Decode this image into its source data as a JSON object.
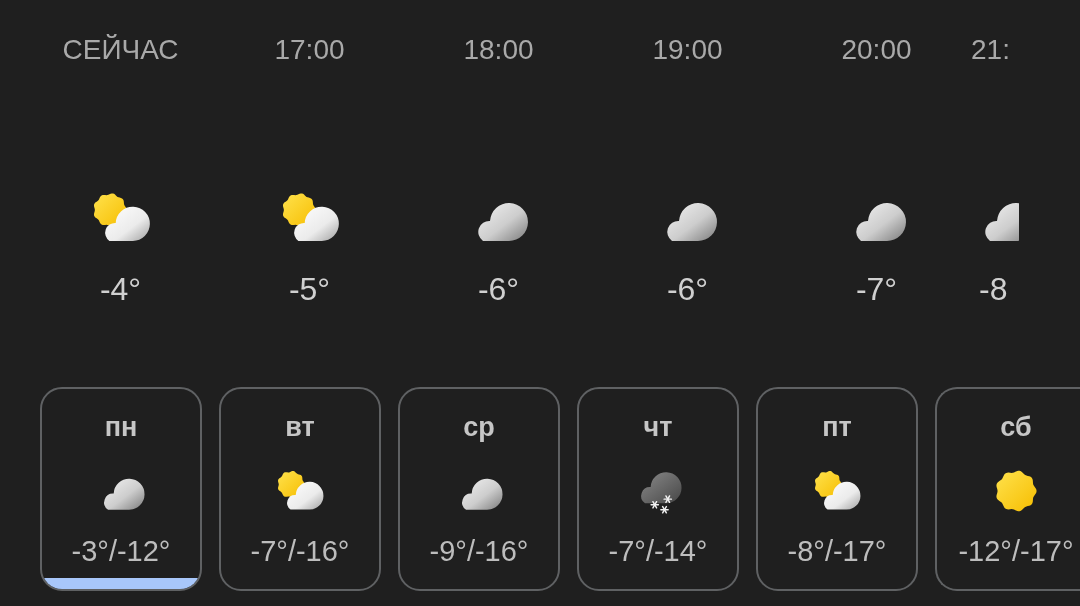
{
  "hourly": [
    {
      "time": "СЕЙЧАС",
      "kind": "partly_cloudy",
      "temperature": "-4°"
    },
    {
      "time": "17:00",
      "kind": "partly_cloudy",
      "temperature": "-5°"
    },
    {
      "time": "18:00",
      "kind": "cloudy",
      "temperature": "-6°"
    },
    {
      "time": "19:00",
      "kind": "cloudy",
      "temperature": "-6°"
    },
    {
      "time": "20:00",
      "kind": "cloudy",
      "temperature": "-7°"
    },
    {
      "time": "21:",
      "kind": "cloudy",
      "temperature": "-8"
    }
  ],
  "daily": [
    {
      "day": "пн",
      "kind": "cloudy",
      "range": "-3°/-12°",
      "selected": true
    },
    {
      "day": "вт",
      "kind": "partly_cloudy",
      "range": "-7°/-16°",
      "selected": false
    },
    {
      "day": "ср",
      "kind": "cloudy",
      "range": "-9°/-16°",
      "selected": false
    },
    {
      "day": "чт",
      "kind": "snow",
      "range": "-7°/-14°",
      "selected": false
    },
    {
      "day": "пт",
      "kind": "partly_cloudy",
      "range": "-8°/-17°",
      "selected": false
    },
    {
      "day": "сб",
      "kind": "sunny",
      "range": "-12°/-17°",
      "selected": false
    }
  ]
}
